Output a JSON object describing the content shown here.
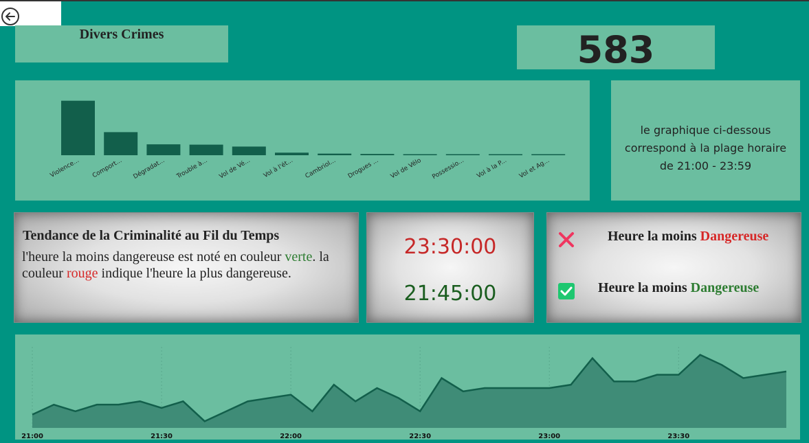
{
  "header": {
    "title": "Divers Crimes",
    "count": "583"
  },
  "note": {
    "line1": "le graphique ci-dessous",
    "line2": "correspond à la plage horaire",
    "line3": "de 21:00 - 23:59"
  },
  "trend_card": {
    "title": "Tendance de la Criminalité au Fil du Temps",
    "text_a": "l'heure la moins dangereuse est noté en couleur",
    "word_green": "verte",
    "text_b": ". la couleur ",
    "word_red": "rouge",
    "text_c": " indique l'heure la plus dangereuse."
  },
  "times": {
    "most_dangerous": "23:30:00",
    "least_dangerous": "21:45:00"
  },
  "legend": {
    "label1_prefix": "Heure la moins ",
    "label1_word": "Dangereuse",
    "label2_prefix": "Heure la moins ",
    "label2_word": "Dangereuse"
  },
  "colors": {
    "background": "#009482",
    "panel": "#6bbea0",
    "bar": "#125f4b",
    "area_fill": "#3f8c77",
    "red": "#d62828",
    "green": "#2e7d32"
  },
  "icons": {
    "back": "back-arrow-icon",
    "cross": "red-x-icon",
    "check": "green-check-icon"
  },
  "chart_data": [
    {
      "type": "bar",
      "categories": [
        "Violence...",
        "Comport...",
        "Dégradat...",
        "Trouble à...",
        "Vol de Vé...",
        "Vol à l'ét...",
        "Cambriol...",
        "Drogues ...",
        "Vol de Vélo",
        "Possessio...",
        "Vol à la P...",
        "Vol et Ag..."
      ],
      "values": [
        170,
        72,
        34,
        33,
        27,
        8,
        5,
        4,
        3,
        2,
        2,
        2
      ],
      "ylim": [
        0,
        180
      ]
    },
    {
      "type": "area",
      "x": [
        "21:00",
        "21:05",
        "21:10",
        "21:15",
        "21:20",
        "21:25",
        "21:30",
        "21:35",
        "21:40",
        "21:45",
        "21:50",
        "21:55",
        "22:00",
        "22:05",
        "22:10",
        "22:15",
        "22:20",
        "22:25",
        "22:30",
        "22:35",
        "22:40",
        "22:45",
        "22:50",
        "22:55",
        "23:00",
        "23:05",
        "23:10",
        "23:15",
        "23:20",
        "23:25",
        "23:30",
        "23:35",
        "23:40",
        "23:45",
        "23:50",
        "23:55"
      ],
      "values": [
        4,
        7,
        5,
        7,
        7,
        8,
        6,
        8,
        2,
        5,
        8,
        9,
        10,
        5,
        13,
        8,
        12,
        9,
        5,
        15,
        11,
        12,
        12,
        12,
        12,
        13,
        21,
        14,
        14,
        16,
        16,
        22,
        19,
        15,
        16,
        17
      ],
      "xticks": [
        "21:00",
        "21:30",
        "22:00",
        "22:30",
        "23:00",
        "23:30"
      ],
      "ylim": [
        0,
        24
      ]
    }
  ]
}
